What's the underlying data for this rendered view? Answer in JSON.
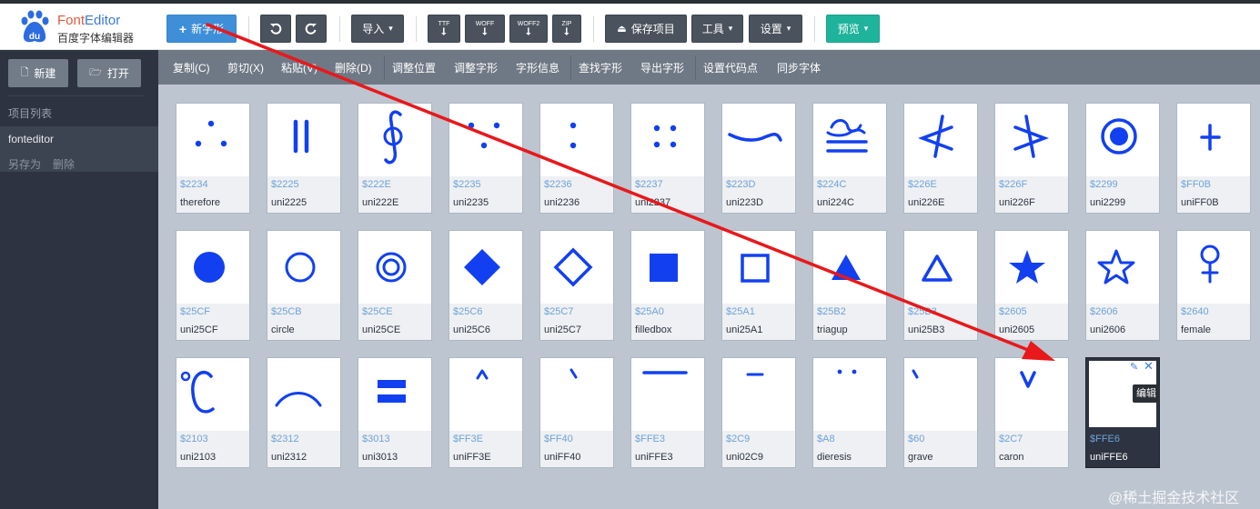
{
  "app": {
    "logo_text": "du",
    "title_a": "Font",
    "title_b": "Editor",
    "subtitle": "百度字体编辑器"
  },
  "toolbar": {
    "new_glyph": "新字形",
    "undo_icon": "undo-icon",
    "redo_icon": "redo-icon",
    "import": "导入",
    "ttf": "TTF",
    "woff": "WOFF",
    "woff2": "WOFF2",
    "zip": "ZIP",
    "save_project": "保存项目",
    "tools": "工具",
    "settings": "设置",
    "preview": "预览"
  },
  "sidebar": {
    "new": "新建",
    "open": "打开",
    "project_list_title": "项目列表",
    "project_name": "fonteditor",
    "save_as": "另存为",
    "delete": "删除"
  },
  "editbar": {
    "items": [
      "复制(C)",
      "剪切(X)",
      "粘贴(V)",
      "删除(D)",
      "调整位置",
      "调整字形",
      "字形信息",
      "查找字形",
      "导出字形",
      "设置代码点",
      "同步字体"
    ]
  },
  "glyphs": [
    {
      "code": "$2234",
      "name": "therefore"
    },
    {
      "code": "$2225",
      "name": "uni2225"
    },
    {
      "code": "$222E",
      "name": "uni222E"
    },
    {
      "code": "$2235",
      "name": "uni2235"
    },
    {
      "code": "$2236",
      "name": "uni2236"
    },
    {
      "code": "$2237",
      "name": "uni2237"
    },
    {
      "code": "$223D",
      "name": "uni223D"
    },
    {
      "code": "$224C",
      "name": "uni224C"
    },
    {
      "code": "$226E",
      "name": "uni226E"
    },
    {
      "code": "$226F",
      "name": "uni226F"
    },
    {
      "code": "$2299",
      "name": "uni2299"
    },
    {
      "code": "$FF0B",
      "name": "uniFF0B"
    },
    {
      "code": "$25CF",
      "name": "uni25CF"
    },
    {
      "code": "$25CB",
      "name": "circle"
    },
    {
      "code": "$25CE",
      "name": "uni25CE"
    },
    {
      "code": "$25C6",
      "name": "uni25C6"
    },
    {
      "code": "$25C7",
      "name": "uni25C7"
    },
    {
      "code": "$25A0",
      "name": "filledbox"
    },
    {
      "code": "$25A1",
      "name": "uni25A1"
    },
    {
      "code": "$25B2",
      "name": "triagup"
    },
    {
      "code": "$25B3",
      "name": "uni25B3"
    },
    {
      "code": "$2605",
      "name": "uni2605"
    },
    {
      "code": "$2606",
      "name": "uni2606"
    },
    {
      "code": "$2640",
      "name": "female"
    },
    {
      "code": "$2103",
      "name": "uni2103"
    },
    {
      "code": "$2312",
      "name": "uni2312"
    },
    {
      "code": "$3013",
      "name": "uni3013"
    },
    {
      "code": "$FF3E",
      "name": "uniFF3E"
    },
    {
      "code": "$FF40",
      "name": "uniFF40"
    },
    {
      "code": "$FFE3",
      "name": "uniFFE3"
    },
    {
      "code": "$2C9",
      "name": "uni02C9"
    },
    {
      "code": "$A8",
      "name": "dieresis"
    },
    {
      "code": "$60",
      "name": "grave"
    },
    {
      "code": "$2C7",
      "name": "caron"
    },
    {
      "code": "$FFE6",
      "name": "uniFFE6"
    }
  ],
  "tooltip": "编辑",
  "watermark": "@稀土掘金技术社区",
  "colors": {
    "glyph": "#1240f0",
    "arrow": "#e8181b",
    "primary": "#3f8fd8",
    "preview": "#20b39b"
  }
}
